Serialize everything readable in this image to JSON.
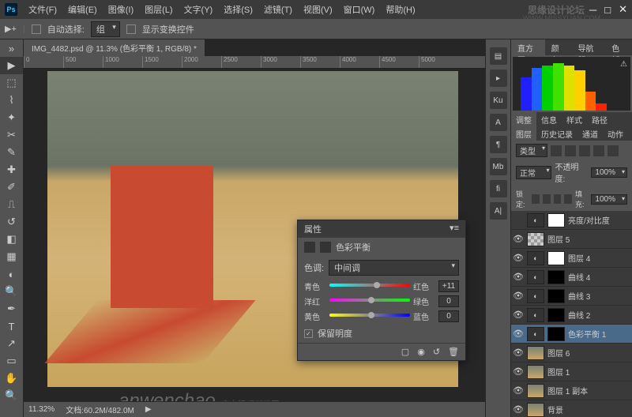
{
  "titlebar": {
    "app": "Ps"
  },
  "menu": {
    "file": "文件(F)",
    "edit": "编辑(E)",
    "image": "图像(I)",
    "layer": "图层(L)",
    "type": "文字(Y)",
    "select": "选择(S)",
    "filter": "滤镜(T)",
    "view": "视图(V)",
    "window": "窗口(W)",
    "help": "帮助(H)"
  },
  "branding": {
    "top": "思缘设计论坛",
    "site": "WWW.MISSYUAN.COM"
  },
  "options": {
    "auto_select": "自动选择:",
    "group": "组",
    "show_transform": "显示变换控件"
  },
  "doc": {
    "title": "IMG_4482.psd @ 11.3% (色彩平衡 1, RGB/8) *"
  },
  "ruler": [
    "0",
    "500",
    "1000",
    "1500",
    "2000",
    "2500",
    "3000",
    "3500",
    "4000",
    "4500",
    "5000"
  ],
  "status": {
    "zoom": "11.32%",
    "filesize": "文档:60.2M/482.0M"
  },
  "watermark": {
    "text": "anwenchao",
    "sub": "安文超 高端修图"
  },
  "histogram_tabs": {
    "histogram": "直方图",
    "color": "颜色",
    "navigator": "导航器",
    "swatches": "色板"
  },
  "adj_tabs": {
    "adjustments": "调整",
    "info": "信息",
    "styles": "样式",
    "paths": "路径"
  },
  "layer_panel_tabs": {
    "layers": "图层",
    "history": "历史记录",
    "channels": "通道",
    "actions": "动作"
  },
  "layer_opts": {
    "kind": "类型",
    "normal": "正常",
    "opacity_label": "不透明度:",
    "opacity": "100%",
    "lock": "锁定:",
    "fill_label": "填充:",
    "fill": "100%"
  },
  "layers": [
    {
      "name": "亮度/对比度",
      "eye": false,
      "thumbs": [
        "adj",
        "mask"
      ]
    },
    {
      "name": "图层 5",
      "eye": true,
      "thumbs": [
        "chk"
      ]
    },
    {
      "name": "图层 4",
      "eye": true,
      "thumbs": [
        "adj",
        "mask"
      ]
    },
    {
      "name": "曲线 4",
      "eye": true,
      "thumbs": [
        "adj",
        "mask_blk"
      ]
    },
    {
      "name": "曲线 3",
      "eye": true,
      "thumbs": [
        "adj",
        "mask_blk"
      ]
    },
    {
      "name": "曲线 2",
      "eye": true,
      "thumbs": [
        "adj",
        "mask_blk"
      ]
    },
    {
      "name": "色彩平衡 1",
      "eye": true,
      "thumbs": [
        "adj",
        "mask_blk"
      ],
      "sel": true
    },
    {
      "name": "图层 6",
      "eye": true,
      "thumbs": [
        "photo"
      ]
    },
    {
      "name": "图层 1",
      "eye": true,
      "thumbs": [
        "photo"
      ]
    },
    {
      "name": "图层 1 副本",
      "eye": true,
      "thumbs": [
        "photo"
      ]
    },
    {
      "name": "背景",
      "eye": true,
      "thumbs": [
        "photo"
      ]
    }
  ],
  "properties": {
    "panel": "属性",
    "title": "色彩平衡",
    "tone_label": "色调:",
    "tone_value": "中间调",
    "cyan": "青色",
    "red": "红色",
    "val1": "+11",
    "magenta": "洋红",
    "green": "绿色",
    "val2": "0",
    "yellow": "黄色",
    "blue": "蓝色",
    "val3": "0",
    "preserve": "保留明度"
  }
}
